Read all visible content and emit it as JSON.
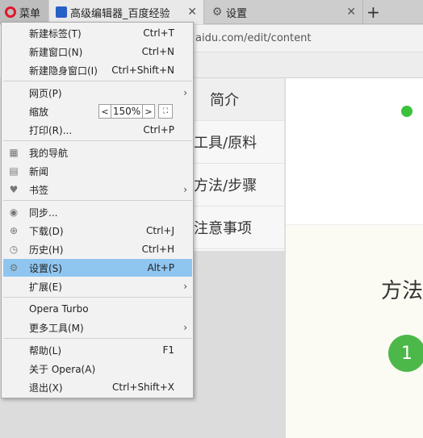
{
  "tabbar": {
    "menu_label": "菜单",
    "active_tab_title": "高级编辑器_百度经验",
    "settings_tab_title": "设置",
    "close_glyph": "✕",
    "newtab_glyph": "+"
  },
  "address": {
    "url_visible": "aidu.com/edit/content"
  },
  "page": {
    "nav": [
      "简介",
      "工具/原料",
      "方法/步骤",
      "注意事项"
    ],
    "section_title": "方法",
    "step_number": "1",
    "accent_color": "#3cc23a"
  },
  "menu": {
    "new_tab": {
      "label": "新建标签(T)",
      "shortcut": "Ctrl+T"
    },
    "new_window": {
      "label": "新建窗口(N)",
      "shortcut": "Ctrl+N"
    },
    "new_private": {
      "label": "新建隐身窗口(I)",
      "shortcut": "Ctrl+Shift+N"
    },
    "page": {
      "label": "网页(P)"
    },
    "zoom": {
      "label": "缩放",
      "value": "150%",
      "dec": "<",
      "inc": ">",
      "fullscreen": "⛶"
    },
    "print": {
      "label": "打印(R)...",
      "shortcut": "Ctrl+P"
    },
    "speed_dial": {
      "label": "我的导航"
    },
    "news": {
      "label": "新闻"
    },
    "bookmarks": {
      "label": "书签"
    },
    "sync": {
      "label": "同步..."
    },
    "downloads": {
      "label": "下载(D)",
      "shortcut": "Ctrl+J"
    },
    "history": {
      "label": "历史(H)",
      "shortcut": "Ctrl+H"
    },
    "settings": {
      "label": "设置(S)",
      "shortcut": "Alt+P"
    },
    "extensions": {
      "label": "扩展(E)"
    },
    "turbo": {
      "label": "Opera Turbo"
    },
    "more_tools": {
      "label": "更多工具(M)"
    },
    "help": {
      "label": "帮助(L)",
      "shortcut": "F1"
    },
    "about": {
      "label": "关于 Opera(A)"
    },
    "exit": {
      "label": "退出(X)",
      "shortcut": "Ctrl+Shift+X"
    },
    "submenu_arrow": "›",
    "highlight_color": "#8fc6f0"
  }
}
